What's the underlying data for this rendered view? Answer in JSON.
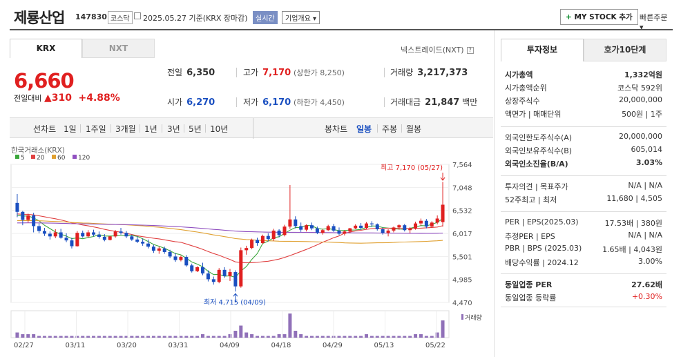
{
  "header": {
    "title": "제룡산업",
    "code": "147830",
    "market": "코스닥",
    "date": "2025.05.27 기준(KRX 장마감)",
    "realtime": "실시간",
    "company_info": "기업개요",
    "mystock": "MY STOCK 추가",
    "quick_order": "빠른주문"
  },
  "tabs": {
    "krx": "KRX",
    "nxt": "NXT"
  },
  "nxt_label": "넥스트레이드(NXT)",
  "quote": {
    "price": "6,660",
    "change_label": "전일대비",
    "change_value": "310",
    "change_pct": "+4.88%",
    "prev_label": "전일",
    "prev": "6,350",
    "high_label": "고가",
    "high": "7,170",
    "upper_limit": "(상한가 8,250)",
    "volume_label": "거래량",
    "volume": "3,217,373",
    "open_label": "시가",
    "open": "6,270",
    "low_label": "저가",
    "low": "6,170",
    "lower_limit": "(하한가 4,450)",
    "amount_label": "거래대금",
    "amount": "21,847",
    "amount_unit": "백만"
  },
  "periods": {
    "line": "선차트",
    "items": [
      "1일",
      "1주일",
      "3개월",
      "1년",
      "3년",
      "5년",
      "10년"
    ],
    "candle": "봉차트",
    "candle_items": [
      "일봉",
      "주봉",
      "월봉"
    ],
    "selected": "일봉"
  },
  "chart_data": {
    "type": "candlestick",
    "source_label": "한국거래소(KRX)",
    "legend": [
      {
        "name": "5",
        "color": "#3aa63a"
      },
      {
        "name": "20",
        "color": "#e04040"
      },
      {
        "name": "60",
        "color": "#e0a030"
      },
      {
        "name": "120",
        "color": "#9050c0"
      }
    ],
    "y_ticks": [
      "7,564",
      "7,048",
      "6,532",
      "6,017",
      "5,501",
      "4,985",
      "4,470"
    ],
    "ylim": [
      4470,
      7564
    ],
    "x_ticks": [
      "02/27",
      "03/11",
      "03/20",
      "03/31",
      "04/09",
      "04/18",
      "04/29",
      "05/13",
      "05/22"
    ],
    "max_annotation": "최고 7,170 (05/27)",
    "min_annotation": "최저 4,715 (04/09)",
    "volume_label": "거래량",
    "candles": [
      [
        6700,
        6900,
        6380,
        6500
      ],
      [
        6500,
        6520,
        6200,
        6320
      ],
      [
        6320,
        6460,
        6260,
        6420
      ],
      [
        6420,
        6480,
        6040,
        6180
      ],
      [
        6180,
        6240,
        6020,
        6070
      ],
      [
        6070,
        6140,
        5960,
        6010
      ],
      [
        6010,
        6060,
        5880,
        5950
      ],
      [
        5950,
        6110,
        5910,
        6040
      ],
      [
        6040,
        6120,
        5900,
        5920
      ],
      [
        5920,
        6020,
        5820,
        5860
      ],
      [
        5860,
        5920,
        5680,
        5730
      ],
      [
        5730,
        6070,
        5720,
        6030
      ],
      [
        6030,
        6080,
        5920,
        5950
      ],
      [
        5950,
        6090,
        5920,
        6040
      ],
      [
        6040,
        6100,
        5950,
        5990
      ],
      [
        5990,
        6060,
        5900,
        5940
      ],
      [
        5940,
        6000,
        5840,
        5870
      ],
      [
        5870,
        5960,
        5860,
        5950
      ],
      [
        5950,
        6090,
        5920,
        6060
      ],
      [
        6060,
        6140,
        5990,
        6030
      ],
      [
        6030,
        6070,
        5910,
        5950
      ],
      [
        5950,
        5990,
        5850,
        5880
      ],
      [
        5880,
        5950,
        5800,
        5830
      ],
      [
        5830,
        5900,
        5740,
        5790
      ],
      [
        5790,
        5880,
        5680,
        5720
      ],
      [
        5720,
        5760,
        5580,
        5630
      ],
      [
        5630,
        5720,
        5560,
        5680
      ],
      [
        5680,
        5720,
        5560,
        5600
      ],
      [
        5600,
        5650,
        5460,
        5500
      ],
      [
        5500,
        5580,
        5380,
        5420
      ],
      [
        5420,
        5520,
        5390,
        5490
      ],
      [
        5490,
        5530,
        5270,
        5300
      ],
      [
        5300,
        5340,
        5140,
        5170
      ],
      [
        5170,
        5280,
        5150,
        5260
      ],
      [
        5260,
        5360,
        5080,
        5120
      ],
      [
        5120,
        5190,
        4940,
        4990
      ],
      [
        4990,
        5050,
        4870,
        4930
      ],
      [
        4930,
        5240,
        4900,
        5200
      ],
      [
        5200,
        5260,
        5020,
        5060
      ],
      [
        5060,
        5220,
        4950,
        5150
      ],
      [
        5150,
        5190,
        4715,
        4830
      ],
      [
        4830,
        5700,
        4800,
        5640
      ],
      [
        5640,
        5740,
        5540,
        5690
      ],
      [
        5690,
        5900,
        5660,
        5870
      ],
      [
        5870,
        5920,
        5740,
        5800
      ],
      [
        5800,
        5990,
        5780,
        5960
      ],
      [
        5960,
        6020,
        5840,
        5890
      ],
      [
        5890,
        6120,
        5850,
        6080
      ],
      [
        6080,
        6110,
        5930,
        5980
      ],
      [
        5980,
        6210,
        5950,
        6170
      ],
      [
        6170,
        7100,
        6120,
        6330
      ],
      [
        6330,
        6400,
        6130,
        6180
      ],
      [
        6180,
        6260,
        6050,
        6100
      ],
      [
        6100,
        6220,
        6060,
        6200
      ],
      [
        6200,
        6260,
        6090,
        6130
      ],
      [
        6130,
        6170,
        6000,
        6030
      ],
      [
        6030,
        6120,
        5990,
        6090
      ],
      [
        6090,
        6210,
        6070,
        6180
      ],
      [
        6180,
        6230,
        6050,
        6080
      ],
      [
        6080,
        6150,
        5980,
        6010
      ],
      [
        6010,
        6090,
        5970,
        6060
      ],
      [
        6060,
        6140,
        6020,
        6130
      ],
      [
        6130,
        6220,
        6110,
        6190
      ],
      [
        6190,
        6250,
        6100,
        6140
      ],
      [
        6140,
        6270,
        6110,
        6240
      ],
      [
        6240,
        6290,
        6160,
        6220
      ],
      [
        6220,
        6240,
        6080,
        6110
      ],
      [
        6110,
        6150,
        5990,
        6030
      ],
      [
        6030,
        6110,
        5950,
        6080
      ],
      [
        6080,
        6170,
        6040,
        6150
      ],
      [
        6150,
        6220,
        6100,
        6200
      ],
      [
        6200,
        6230,
        6060,
        6090
      ],
      [
        6090,
        6160,
        6020,
        6130
      ],
      [
        6130,
        6280,
        6100,
        6240
      ],
      [
        6240,
        6350,
        6190,
        6300
      ],
      [
        6300,
        6340,
        6130,
        6170
      ],
      [
        6170,
        6290,
        6140,
        6260
      ],
      [
        6260,
        6420,
        6220,
        6350
      ],
      [
        6270,
        7170,
        6170,
        6660
      ]
    ],
    "volumes": [
      3,
      2,
      2,
      2,
      1,
      1,
      1,
      1,
      1,
      1,
      1,
      1,
      1,
      1,
      1,
      1,
      1,
      1,
      1,
      1,
      1,
      1,
      1,
      1,
      1,
      1,
      1,
      1,
      1,
      1,
      1,
      1,
      1,
      1,
      2,
      1,
      1,
      1,
      1,
      2,
      4,
      7,
      3,
      2,
      1,
      1,
      1,
      1,
      2,
      2,
      14,
      4,
      2,
      1,
      1,
      1,
      1,
      1,
      1,
      1,
      1,
      1,
      1,
      1,
      2,
      1,
      1,
      1,
      1,
      1,
      1,
      1,
      1,
      2,
      2,
      1,
      1,
      3,
      10
    ]
  },
  "invest": {
    "tab_active": "투자정보",
    "tab_inactive": "호가10단계",
    "rows1": [
      {
        "l": "시가총액",
        "r": "1,332억원",
        "bold": true
      },
      {
        "l": "시가총액순위",
        "r": "코스닥 592위"
      },
      {
        "l": "상장주식수",
        "r": "20,000,000"
      },
      {
        "l": "액면가 | 매매단위",
        "r": "500원 | 1주"
      }
    ],
    "rows2": [
      {
        "l": "외국인한도주식수(A)",
        "r": "20,000,000"
      },
      {
        "l": "외국인보유주식수(B)",
        "r": "605,014"
      },
      {
        "l": "외국인소진율(B/A)",
        "r": "3.03%",
        "bold": true
      }
    ],
    "rows3": [
      {
        "l": "투자의견 | 목표주가",
        "r": "N/A | N/A"
      },
      {
        "l": "52주최고 | 최저",
        "r": "11,680 | 4,505"
      }
    ],
    "rows4": [
      {
        "l": "PER | EPS(2025.03)",
        "r": "17.53배 | 380원"
      },
      {
        "l": "추정PER | EPS",
        "r": "N/A | N/A"
      },
      {
        "l": "PBR | BPS (2025.03)",
        "r": "1.65배 | 4,043원"
      },
      {
        "l": "배당수익률 | 2024.12",
        "r": "3.00%"
      }
    ],
    "rows5": [
      {
        "l": "동일업종 PER",
        "r": "27.62배",
        "bold": true
      },
      {
        "l": "동일업종 등락률",
        "r": "+0.30%",
        "red": true
      }
    ]
  },
  "colors": {
    "up": "#e02020",
    "down": "#1a4fc0"
  }
}
